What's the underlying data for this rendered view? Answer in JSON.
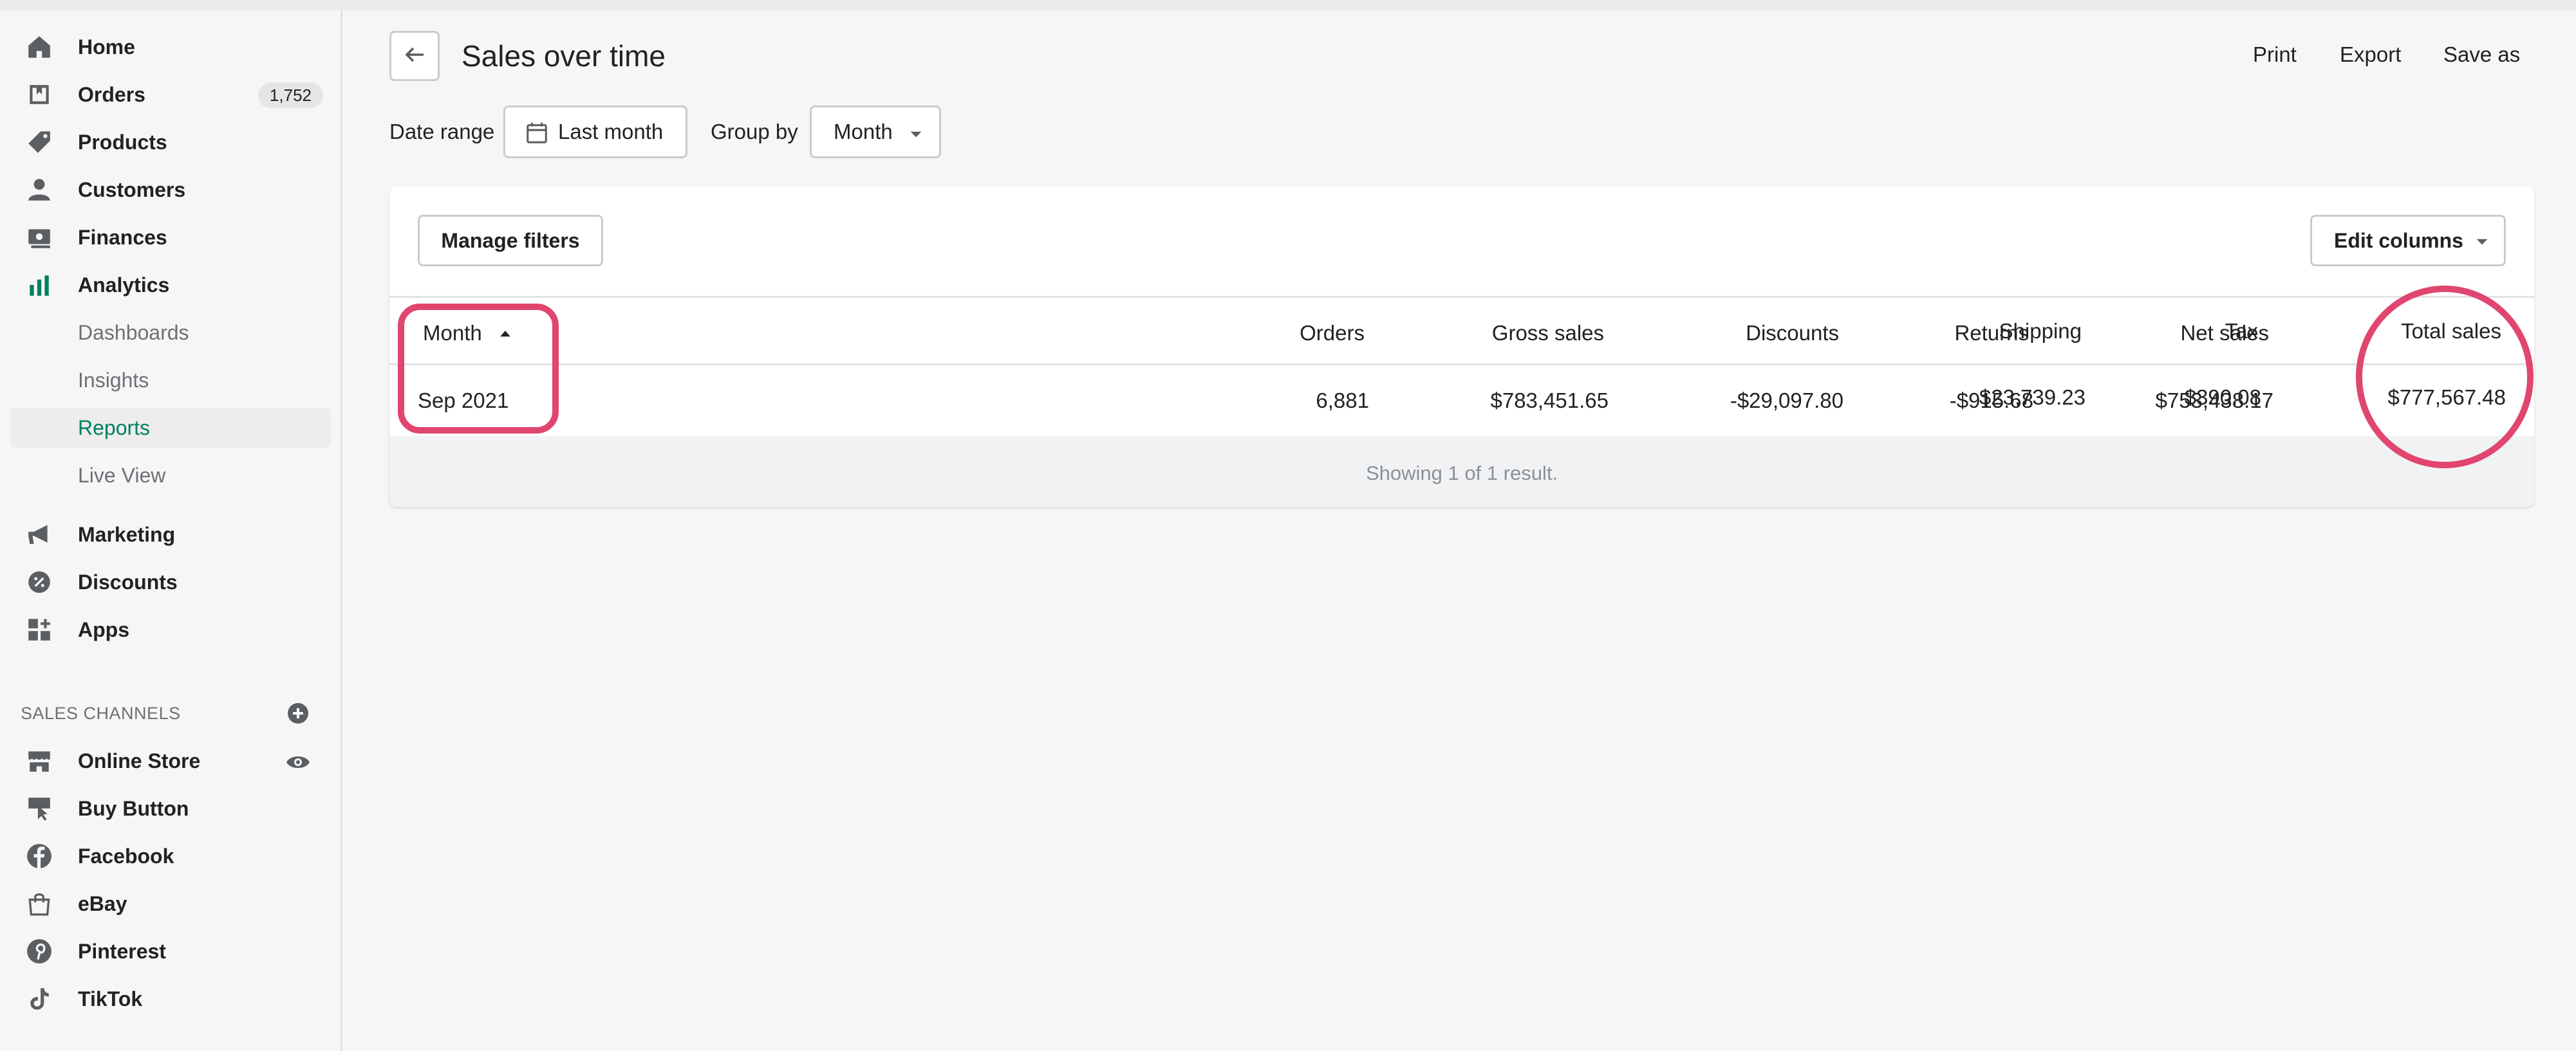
{
  "sidebar": {
    "items": [
      {
        "label": "Home",
        "icon": "home-icon"
      },
      {
        "label": "Orders",
        "icon": "orders-icon",
        "badge": "1,752"
      },
      {
        "label": "Products",
        "icon": "tag-icon"
      },
      {
        "label": "Customers",
        "icon": "person-icon"
      },
      {
        "label": "Finances",
        "icon": "finances-icon"
      },
      {
        "label": "Analytics",
        "icon": "bar-chart-icon"
      }
    ],
    "analytics_sub": [
      {
        "label": "Dashboards"
      },
      {
        "label": "Insights"
      },
      {
        "label": "Reports",
        "active": true
      },
      {
        "label": "Live View"
      }
    ],
    "items2": [
      {
        "label": "Marketing",
        "icon": "megaphone-icon"
      },
      {
        "label": "Discounts",
        "icon": "discount-icon"
      },
      {
        "label": "Apps",
        "icon": "apps-icon"
      }
    ],
    "sales_channels_label": "SALES CHANNELS",
    "channels": [
      {
        "label": "Online Store",
        "icon": "store-icon"
      },
      {
        "label": "Buy Button",
        "icon": "buy-button-icon"
      },
      {
        "label": "Facebook",
        "icon": "facebook-icon"
      },
      {
        "label": "eBay",
        "icon": "shopping-bag-icon"
      },
      {
        "label": "Pinterest",
        "icon": "pinterest-icon"
      },
      {
        "label": "TikTok",
        "icon": "tiktok-icon"
      }
    ]
  },
  "header": {
    "title": "Sales over time",
    "actions": [
      "Print",
      "Export",
      "Save as"
    ]
  },
  "filters": {
    "date_range_label": "Date range",
    "date_range_value": "Last month",
    "group_by_label": "Group by",
    "group_by_value": "Month"
  },
  "card": {
    "manage_filters": "Manage filters",
    "edit_columns": "Edit columns"
  },
  "table": {
    "columns": [
      "Month",
      "Orders",
      "Gross sales",
      "Discounts",
      "Returns",
      "Net sales",
      "Shipping",
      "Tax",
      "Total sales"
    ],
    "rows": [
      [
        "Sep 2021",
        "6,881",
        "$783,451.65",
        "-$29,097.80",
        "-$915.68",
        "$753,438.17",
        "$23,739.23",
        "$390.08",
        "$777,567.48"
      ]
    ],
    "footer": "Showing 1 of 1 result."
  },
  "colors": {
    "accent": "#008060",
    "annotation": "#e0466f"
  }
}
